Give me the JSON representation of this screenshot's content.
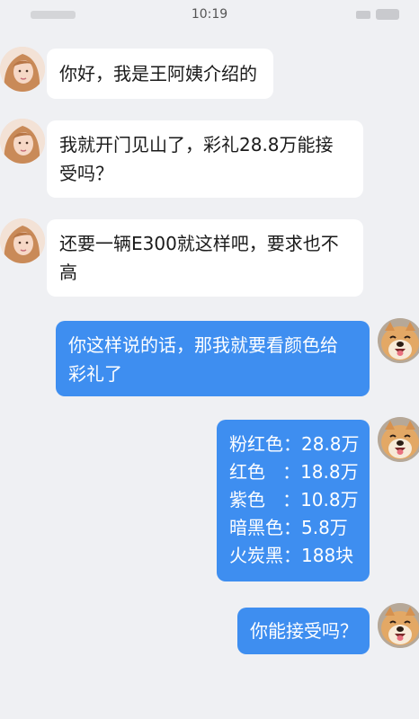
{
  "status_bar": {
    "time": "10:19"
  },
  "messages": [
    {
      "sender": "她",
      "lines": [
        "你好，我是王阿姨介绍的"
      ]
    },
    {
      "sender": "她",
      "lines": [
        "我就开门见山了，彩礼28.8万能接",
        "受吗？"
      ]
    },
    {
      "sender": "她",
      "lines": [
        "还要一辆E300就这样吧，要求也不",
        "高"
      ]
    },
    {
      "sender": "我",
      "lines": [
        "你这样说的话，那我就要看颜色给",
        "彩礼了"
      ]
    },
    {
      "sender": "我",
      "lines": [
        "粉红色：28.8万",
        "红色   ：18.8万",
        "紫色   ：10.8万",
        "暗黑色：5.8万",
        "火炭黑：188块"
      ]
    },
    {
      "sender": "我",
      "lines": [
        "你能接受吗？"
      ]
    }
  ],
  "colors": {
    "outgoing_bubble": "#3e8ef0",
    "incoming_bubble": "#ffffff",
    "background": "#eff0f3"
  },
  "icons": {
    "girl_avatar": "girl-avatar",
    "dog_avatar": "shiba-dog-avatar"
  }
}
